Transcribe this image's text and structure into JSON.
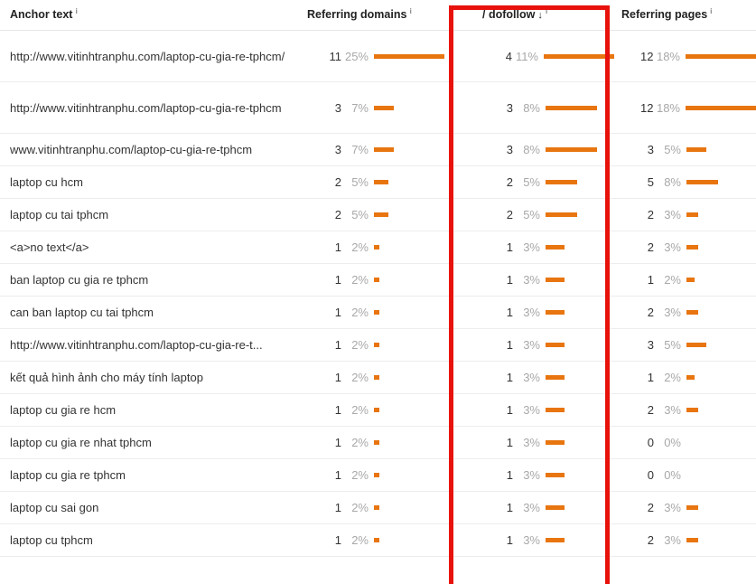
{
  "table": {
    "columns": {
      "anchor": {
        "label": "Anchor text",
        "info": "i"
      },
      "domains": {
        "label": "Referring domains",
        "info": "i"
      },
      "dofollow": {
        "label": "/ dofollow",
        "sort": "↓",
        "info": "i"
      },
      "pages": {
        "label": "Referring pages",
        "info": "i"
      }
    },
    "rows": [
      {
        "anchor": "http://www.vitinhtranphu.com/laptop-cu-gia-re-tphcm/",
        "domains_n": "11",
        "domains_p": "25%",
        "domains_v": 25,
        "dofollow_n": "4",
        "dofollow_p": "11%",
        "dofollow_v": 11,
        "pages_n": "12",
        "pages_p": "18%",
        "pages_v": 18
      },
      {
        "anchor": "http://www.vitinhtranphu.com/laptop-cu-gia-re-tphcm",
        "domains_n": "3",
        "domains_p": "7%",
        "domains_v": 7,
        "dofollow_n": "3",
        "dofollow_p": "8%",
        "dofollow_v": 8,
        "pages_n": "12",
        "pages_p": "18%",
        "pages_v": 18
      },
      {
        "anchor": "www.vitinhtranphu.com/laptop-cu-gia-re-tphcm",
        "domains_n": "3",
        "domains_p": "7%",
        "domains_v": 7,
        "dofollow_n": "3",
        "dofollow_p": "8%",
        "dofollow_v": 8,
        "pages_n": "3",
        "pages_p": "5%",
        "pages_v": 5
      },
      {
        "anchor": "laptop cu hcm",
        "domains_n": "2",
        "domains_p": "5%",
        "domains_v": 5,
        "dofollow_n": "2",
        "dofollow_p": "5%",
        "dofollow_v": 5,
        "pages_n": "5",
        "pages_p": "8%",
        "pages_v": 8
      },
      {
        "anchor": "laptop cu tai tphcm",
        "domains_n": "2",
        "domains_p": "5%",
        "domains_v": 5,
        "dofollow_n": "2",
        "dofollow_p": "5%",
        "dofollow_v": 5,
        "pages_n": "2",
        "pages_p": "3%",
        "pages_v": 3
      },
      {
        "anchor": "<a>no text</a>",
        "domains_n": "1",
        "domains_p": "2%",
        "domains_v": 2,
        "dofollow_n": "1",
        "dofollow_p": "3%",
        "dofollow_v": 3,
        "pages_n": "2",
        "pages_p": "3%",
        "pages_v": 3
      },
      {
        "anchor": "ban laptop cu gia re tphcm",
        "domains_n": "1",
        "domains_p": "2%",
        "domains_v": 2,
        "dofollow_n": "1",
        "dofollow_p": "3%",
        "dofollow_v": 3,
        "pages_n": "1",
        "pages_p": "2%",
        "pages_v": 2
      },
      {
        "anchor": "can ban laptop cu tai tphcm",
        "domains_n": "1",
        "domains_p": "2%",
        "domains_v": 2,
        "dofollow_n": "1",
        "dofollow_p": "3%",
        "dofollow_v": 3,
        "pages_n": "2",
        "pages_p": "3%",
        "pages_v": 3
      },
      {
        "anchor": "http://www.vitinhtranphu.com/laptop-cu-gia-re-t...",
        "domains_n": "1",
        "domains_p": "2%",
        "domains_v": 2,
        "dofollow_n": "1",
        "dofollow_p": "3%",
        "dofollow_v": 3,
        "pages_n": "3",
        "pages_p": "5%",
        "pages_v": 5
      },
      {
        "anchor": "kết quả hình ảnh cho máy tính laptop",
        "domains_n": "1",
        "domains_p": "2%",
        "domains_v": 2,
        "dofollow_n": "1",
        "dofollow_p": "3%",
        "dofollow_v": 3,
        "pages_n": "1",
        "pages_p": "2%",
        "pages_v": 2
      },
      {
        "anchor": "laptop cu gia re hcm",
        "domains_n": "1",
        "domains_p": "2%",
        "domains_v": 2,
        "dofollow_n": "1",
        "dofollow_p": "3%",
        "dofollow_v": 3,
        "pages_n": "2",
        "pages_p": "3%",
        "pages_v": 3
      },
      {
        "anchor": "laptop cu gia re nhat tphcm",
        "domains_n": "1",
        "domains_p": "2%",
        "domains_v": 2,
        "dofollow_n": "1",
        "dofollow_p": "3%",
        "dofollow_v": 3,
        "pages_n": "0",
        "pages_p": "0%",
        "pages_v": 0
      },
      {
        "anchor": "laptop cu gia re tphcm",
        "domains_n": "1",
        "domains_p": "2%",
        "domains_v": 2,
        "dofollow_n": "1",
        "dofollow_p": "3%",
        "dofollow_v": 3,
        "pages_n": "0",
        "pages_p": "0%",
        "pages_v": 0
      },
      {
        "anchor": "laptop cu sai gon",
        "domains_n": "1",
        "domains_p": "2%",
        "domains_v": 2,
        "dofollow_n": "1",
        "dofollow_p": "3%",
        "dofollow_v": 3,
        "pages_n": "2",
        "pages_p": "3%",
        "pages_v": 3
      },
      {
        "anchor": "laptop cu tphcm",
        "domains_n": "1",
        "domains_p": "2%",
        "domains_v": 2,
        "dofollow_n": "1",
        "dofollow_p": "3%",
        "dofollow_v": 3,
        "pages_n": "2",
        "pages_p": "3%",
        "pages_v": 3
      }
    ]
  },
  "annotation": {
    "highlight_color": "#e8120c",
    "bar_color": "#e8750f",
    "highlighted_column": "/ dofollow"
  },
  "chart_data": {
    "type": "table",
    "title": "Anchor text backlink distribution",
    "columns": [
      "Anchor text",
      "Referring domains",
      "/ dofollow",
      "Referring pages"
    ],
    "categories": [
      "http://www.vitinhtranphu.com/laptop-cu-gia-re-tphcm/",
      "http://www.vitinhtranphu.com/laptop-cu-gia-re-tphcm",
      "www.vitinhtranphu.com/laptop-cu-gia-re-tphcm",
      "laptop cu hcm",
      "laptop cu tai tphcm",
      "<a>no text</a>",
      "ban laptop cu gia re tphcm",
      "can ban laptop cu tai tphcm",
      "http://www.vitinhtranphu.com/laptop-cu-gia-re-t...",
      "kết quả hình ảnh cho máy tính laptop",
      "laptop cu gia re hcm",
      "laptop cu gia re nhat tphcm",
      "laptop cu gia re tphcm",
      "laptop cu sai gon",
      "laptop cu tphcm"
    ],
    "series": [
      {
        "name": "Referring domains",
        "values": [
          11,
          3,
          3,
          2,
          2,
          1,
          1,
          1,
          1,
          1,
          1,
          1,
          1,
          1,
          1
        ],
        "percents": [
          25,
          7,
          7,
          5,
          5,
          2,
          2,
          2,
          2,
          2,
          2,
          2,
          2,
          2,
          2
        ]
      },
      {
        "name": "/ dofollow",
        "values": [
          4,
          3,
          3,
          2,
          2,
          1,
          1,
          1,
          1,
          1,
          1,
          1,
          1,
          1,
          1
        ],
        "percents": [
          11,
          8,
          8,
          5,
          5,
          3,
          3,
          3,
          3,
          3,
          3,
          3,
          3,
          3,
          3
        ]
      },
      {
        "name": "Referring pages",
        "values": [
          12,
          12,
          3,
          5,
          2,
          2,
          1,
          2,
          3,
          1,
          2,
          0,
          0,
          2,
          2
        ],
        "percents": [
          18,
          18,
          5,
          8,
          3,
          3,
          2,
          3,
          5,
          2,
          3,
          0,
          0,
          3,
          3
        ]
      }
    ],
    "sorted_by": "/ dofollow",
    "sort_direction": "desc",
    "grid": false,
    "legend": "none"
  }
}
